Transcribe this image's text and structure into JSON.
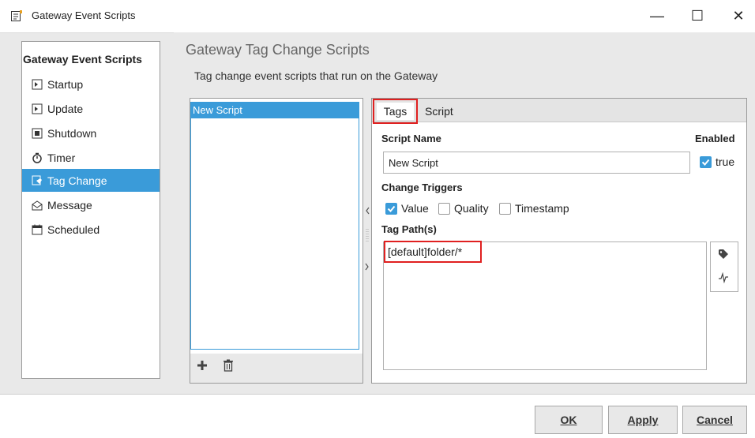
{
  "window": {
    "title": "Gateway Event Scripts",
    "controls": {
      "minimize": "—",
      "maximize": "☐",
      "close": "✕"
    }
  },
  "nav": {
    "title": "Gateway Event Scripts",
    "items": [
      {
        "label": "Startup",
        "icon": "script-icon"
      },
      {
        "label": "Update",
        "icon": "script-icon"
      },
      {
        "label": "Shutdown",
        "icon": "script-icon"
      },
      {
        "label": "Timer",
        "icon": "timer-icon"
      },
      {
        "label": "Tag Change",
        "icon": "tag-change-icon",
        "active": true
      },
      {
        "label": "Message",
        "icon": "message-icon"
      },
      {
        "label": "Scheduled",
        "icon": "calendar-icon"
      }
    ]
  },
  "main": {
    "title": "Gateway Tag Change Scripts",
    "subtitle": "Tag change event scripts that run on the Gateway",
    "scripts": [
      {
        "name": "New Script"
      }
    ],
    "tabs": [
      {
        "label": "Tags",
        "active": true
      },
      {
        "label": "Script"
      }
    ],
    "form": {
      "script_name_label": "Script Name",
      "script_name_value": "New Script",
      "enabled_label": "Enabled",
      "enabled_value": "true",
      "change_triggers_label": "Change Triggers",
      "triggers": [
        {
          "label": "Value",
          "checked": true
        },
        {
          "label": "Quality",
          "checked": false
        },
        {
          "label": "Timestamp",
          "checked": false
        }
      ],
      "tag_paths_label": "Tag Path(s)",
      "tag_paths_value": "[default]folder/*"
    }
  },
  "footer": {
    "ok": "OK",
    "apply": "Apply",
    "cancel": "Cancel"
  },
  "colors": {
    "accent": "#3a9bd9",
    "highlight": "#e02020",
    "panel_bg": "#e9e9e9"
  }
}
